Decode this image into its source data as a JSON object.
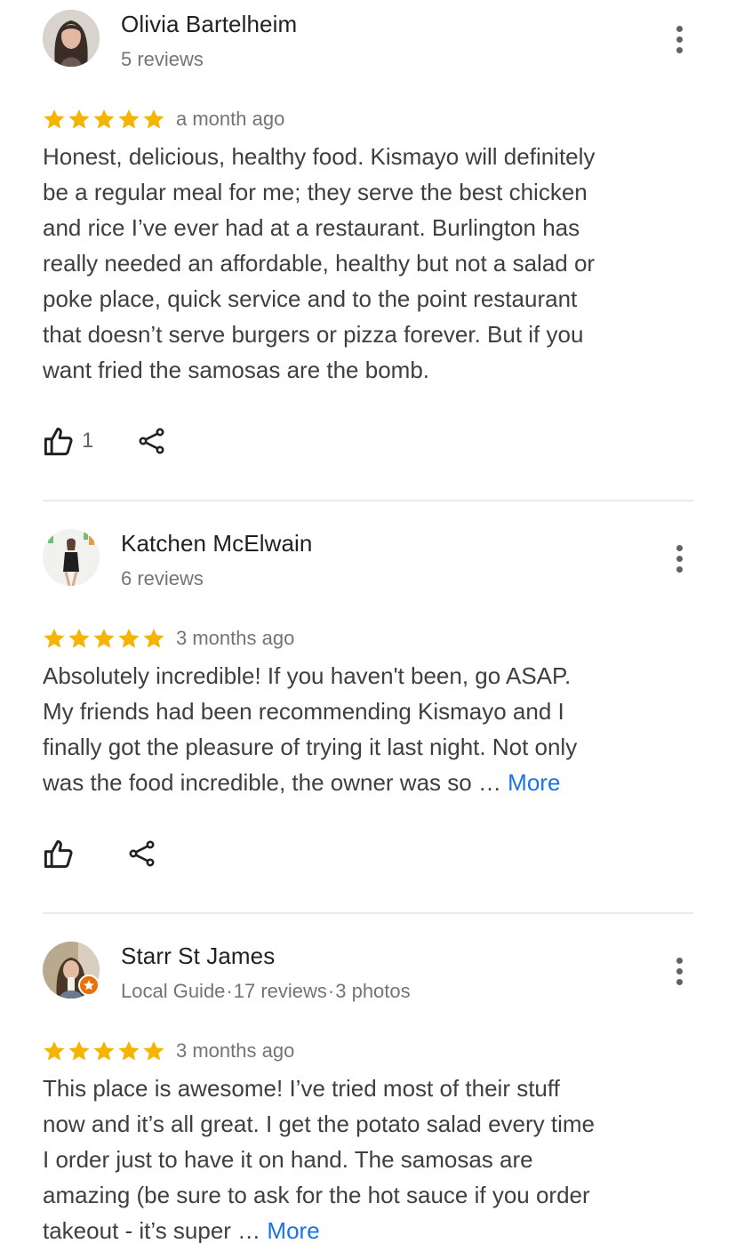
{
  "reviews": [
    {
      "author": "Olivia Bartelheim",
      "meta": "5 reviews",
      "rating": 5,
      "date": "a month ago",
      "lines": [
        "Honest, delicious, healthy food. Kismayo will definitely",
        "be a regular meal for me; they serve the best chicken",
        "and rice I’ve ever had at a restaurant. Burlington has",
        "really needed an affordable, healthy but not a salad or",
        "poke place, quick service and to the point restaurant",
        "that doesn’t serve burgers or pizza forever. But if you",
        "want fried the samosas are the bomb."
      ],
      "likes": "1",
      "more_label": ""
    },
    {
      "author": "Katchen McElwain",
      "meta": "6 reviews",
      "rating": 5,
      "date": "3 months ago",
      "lines": [
        "Absolutely incredible! If you haven't been, go ASAP.",
        "My friends had been recommending Kismayo and I",
        "finally got the pleasure of trying it last night. Not only",
        "was the food incredible, the owner was so … "
      ],
      "likes": "",
      "more_label": "More"
    },
    {
      "author": "Starr St James",
      "meta_parts": [
        "Local Guide",
        "·",
        "17 reviews",
        "·",
        "3 photos"
      ],
      "rating": 5,
      "date": "3 months ago",
      "lines": [
        "This place is awesome! I’ve tried most of their stuff",
        "now and it’s all great. I get the potato salad every time",
        "I order just to have it on hand. The samosas are",
        "amazing (be sure to ask for the hot sauce if you order",
        "takeout - it’s super … "
      ],
      "likes": "",
      "more_label": "More"
    }
  ],
  "colors": {
    "star": "#f4b400",
    "link": "#1a73e8",
    "secondary_text": "#70757a",
    "local_guide_badge": "#e8710a"
  },
  "icons": [
    "thumb-up-icon",
    "share-icon",
    "more-vert-icon",
    "star-icon",
    "local-guide-badge-icon"
  ]
}
